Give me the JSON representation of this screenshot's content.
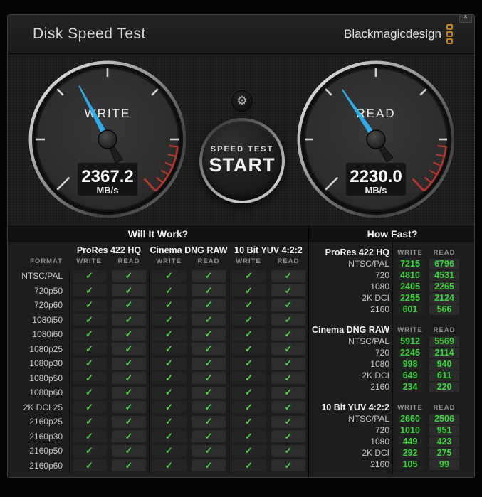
{
  "window": {
    "title": "Disk Speed Test",
    "brand": "Blackmagicdesign",
    "close_glyph": "x"
  },
  "icons": {
    "settings": "⚙",
    "check": "✓"
  },
  "colors": {
    "needle_blue": "#2fabe8",
    "check_green": "#45d73c",
    "value_green": "#3cd43c",
    "redline": "#b5372c",
    "logo_orange": "#bf8118"
  },
  "gauges": {
    "write": {
      "label": "WRITE",
      "value": "2367.2",
      "unit": "MB/s",
      "needle_deg": -28
    },
    "read": {
      "label": "READ",
      "value": "2230.0",
      "unit": "MB/s",
      "needle_deg": -34
    }
  },
  "start_button": {
    "line1": "SPEED TEST",
    "line2": "START"
  },
  "will_it_work": {
    "title": "Will It Work?",
    "format_header": "FORMAT",
    "groups": [
      "ProRes 422 HQ",
      "Cinema DNG RAW",
      "10 Bit YUV 4:2:2"
    ],
    "col_headers": [
      "WRITE",
      "READ",
      "WRITE",
      "READ",
      "WRITE",
      "READ"
    ],
    "rows": [
      {
        "format": "NTSC/PAL",
        "checks": [
          true,
          true,
          true,
          true,
          true,
          true
        ]
      },
      {
        "format": "720p50",
        "checks": [
          true,
          true,
          true,
          true,
          true,
          true
        ]
      },
      {
        "format": "720p60",
        "checks": [
          true,
          true,
          true,
          true,
          true,
          true
        ]
      },
      {
        "format": "1080i50",
        "checks": [
          true,
          true,
          true,
          true,
          true,
          true
        ]
      },
      {
        "format": "1080i60",
        "checks": [
          true,
          true,
          true,
          true,
          true,
          true
        ]
      },
      {
        "format": "1080p25",
        "checks": [
          true,
          true,
          true,
          true,
          true,
          true
        ]
      },
      {
        "format": "1080p30",
        "checks": [
          true,
          true,
          true,
          true,
          true,
          true
        ]
      },
      {
        "format": "1080p50",
        "checks": [
          true,
          true,
          true,
          true,
          true,
          true
        ]
      },
      {
        "format": "1080p60",
        "checks": [
          true,
          true,
          true,
          true,
          true,
          true
        ]
      },
      {
        "format": "2K DCI 25",
        "checks": [
          true,
          true,
          true,
          true,
          true,
          true
        ]
      },
      {
        "format": "2160p25",
        "checks": [
          true,
          true,
          true,
          true,
          true,
          true
        ]
      },
      {
        "format": "2160p30",
        "checks": [
          true,
          true,
          true,
          true,
          true,
          true
        ]
      },
      {
        "format": "2160p50",
        "checks": [
          true,
          true,
          true,
          true,
          true,
          true
        ]
      },
      {
        "format": "2160p60",
        "checks": [
          true,
          true,
          true,
          true,
          true,
          true
        ]
      }
    ]
  },
  "how_fast": {
    "title": "How Fast?",
    "col_headers": [
      "WRITE",
      "READ"
    ],
    "sections": [
      {
        "name": "ProRes 422 HQ",
        "rows": [
          {
            "label": "NTSC/PAL",
            "write": "7215",
            "read": "6796"
          },
          {
            "label": "720",
            "write": "4810",
            "read": "4531"
          },
          {
            "label": "1080",
            "write": "2405",
            "read": "2265"
          },
          {
            "label": "2K DCI",
            "write": "2255",
            "read": "2124"
          },
          {
            "label": "2160",
            "write": "601",
            "read": "566"
          }
        ]
      },
      {
        "name": "Cinema DNG RAW",
        "rows": [
          {
            "label": "NTSC/PAL",
            "write": "5912",
            "read": "5569"
          },
          {
            "label": "720",
            "write": "2245",
            "read": "2114"
          },
          {
            "label": "1080",
            "write": "998",
            "read": "940"
          },
          {
            "label": "2K DCI",
            "write": "649",
            "read": "611"
          },
          {
            "label": "2160",
            "write": "234",
            "read": "220"
          }
        ]
      },
      {
        "name": "10 Bit YUV 4:2:2",
        "rows": [
          {
            "label": "NTSC/PAL",
            "write": "2660",
            "read": "2506"
          },
          {
            "label": "720",
            "write": "1010",
            "read": "951"
          },
          {
            "label": "1080",
            "write": "449",
            "read": "423"
          },
          {
            "label": "2K DCI",
            "write": "292",
            "read": "275"
          },
          {
            "label": "2160",
            "write": "105",
            "read": "99"
          }
        ]
      }
    ]
  }
}
